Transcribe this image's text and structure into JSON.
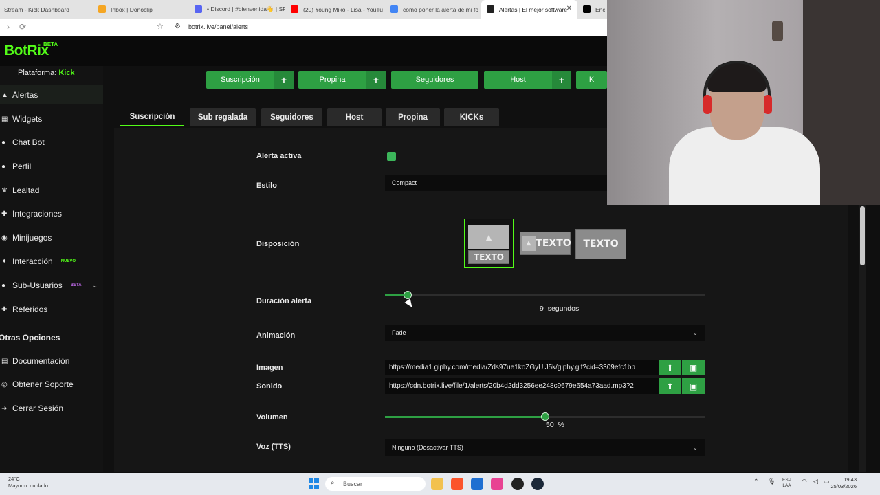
{
  "browser": {
    "tabs": [
      {
        "title": "Stream - Kick Dashboard",
        "color": "#53fc18",
        "active": false
      },
      {
        "title": "Inbox | Donoclip",
        "color": "#f5a623",
        "active": false
      },
      {
        "title": "• Discord | #bienvenida👋 | SR",
        "color": "#5865f2",
        "active": false
      },
      {
        "title": "(20) Young Miko - Lisa - YouTu",
        "color": "#ff0000",
        "active": false
      },
      {
        "title": "como poner la alerta de mi fo",
        "color": "#4285f4",
        "active": false
      },
      {
        "title": "Alertas | El mejor software",
        "color": "#222222",
        "active": true
      },
      {
        "title": "Encue",
        "color": "#000000",
        "active": false
      }
    ],
    "url": "botrix.live/panel/alerts"
  },
  "app": {
    "logo": "BotRix",
    "logo_badge": "BETA",
    "platform_label": "Plataforma:",
    "platform_value": "Kick"
  },
  "sidebar": {
    "items": [
      {
        "label": "Alertas",
        "icon": "alert-icon",
        "glyph": "▲",
        "badge": "",
        "active": true
      },
      {
        "label": "Widgets",
        "icon": "widget-icon",
        "glyph": "▦",
        "badge": "",
        "active": false
      },
      {
        "label": "Chat Bot",
        "icon": "bot-icon",
        "glyph": "●",
        "badge": "",
        "active": false
      },
      {
        "label": "Perfil",
        "icon": "user-icon",
        "glyph": "●",
        "badge": "",
        "active": false
      },
      {
        "label": "Lealtad",
        "icon": "trophy-icon",
        "glyph": "♛",
        "badge": "",
        "active": false
      },
      {
        "label": "Integraciones",
        "icon": "puzzle-icon",
        "glyph": "✚",
        "badge": "",
        "active": false
      },
      {
        "label": "Minijuegos",
        "icon": "gamepad-icon",
        "glyph": "◉",
        "badge": "",
        "active": false
      },
      {
        "label": "Interacción",
        "icon": "interaction-icon",
        "glyph": "✦",
        "badge": "NUEVO",
        "active": false
      },
      {
        "label": "Sub-Usuarios",
        "icon": "users-icon",
        "glyph": "●",
        "badge": "BETA",
        "active": false
      },
      {
        "label": "Referidos",
        "icon": "referral-icon",
        "glyph": "✚",
        "badge": "",
        "active": false
      }
    ],
    "section_title": "Otras Opciones",
    "extra_items": [
      {
        "label": "Documentación",
        "icon": "book-icon",
        "glyph": "▤"
      },
      {
        "label": "Obtener Soporte",
        "icon": "support-icon",
        "glyph": "◎"
      },
      {
        "label": "Cerrar Sesión",
        "icon": "logout-icon",
        "glyph": "➜"
      }
    ]
  },
  "alert_types": [
    {
      "label": "Suscripción",
      "plus": "+"
    },
    {
      "label": "Propina",
      "plus": "+"
    },
    {
      "label": "Seguidores",
      "plus": ""
    },
    {
      "label": "Host",
      "plus": "+"
    },
    {
      "label": "K",
      "plus": ""
    }
  ],
  "sub_tabs": [
    "Suscripción",
    "Sub regalada",
    "Seguidores",
    "Host",
    "Propina",
    "KICKs"
  ],
  "form": {
    "active_label": "Alerta activa",
    "active_value": true,
    "style_label": "Estilo",
    "style_value": "Compact",
    "layout_label": "Disposición",
    "layout_text": "TEXTO",
    "duration_label": "Duración alerta",
    "duration_value": "9",
    "duration_unit": "segundos",
    "duration_fraction": 0.07,
    "animation_label": "Animación",
    "animation_value": "Fade",
    "image_label": "Imagen",
    "image_value": "https://media1.giphy.com/media/Zds97ue1koZGyUiJ5k/giphy.gif?cid=3309efc1bb",
    "sound_label": "Sonido",
    "sound_value": "https://cdn.botrix.live/file/1/alerts/20b4d2dd3256ee248c9679e654a73aad.mp3?2",
    "volume_label": "Volumen",
    "volume_value": "50",
    "volume_unit": "%",
    "volume_fraction": 0.5,
    "tts_label": "Voz (TTS)",
    "tts_value": "Ninguno (Desactivar TTS)"
  },
  "taskbar": {
    "weather_temp": "24°C",
    "weather_desc": "Mayorm. nublado",
    "search_placeholder": "Buscar",
    "lang_top": "ESP",
    "lang_bottom": "LAA",
    "time": "19:43",
    "date": "25/03/2026"
  },
  "colors": {
    "brand": "#53fc18",
    "accent": "#2ea043"
  }
}
